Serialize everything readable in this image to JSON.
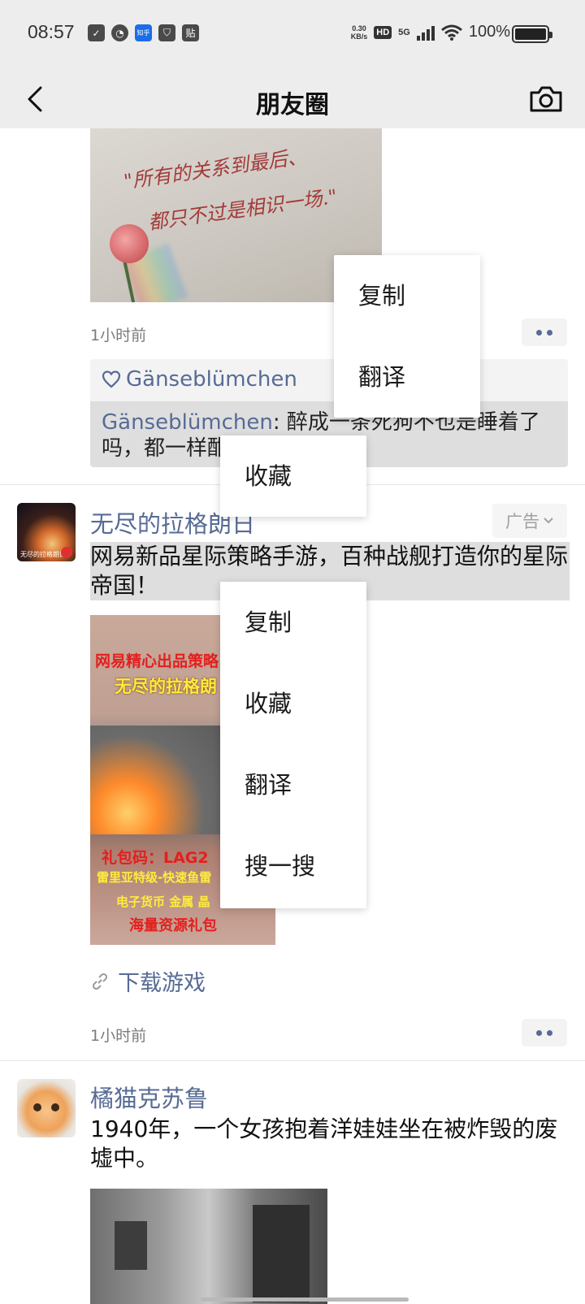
{
  "status_bar": {
    "time": "08:57",
    "left_icons": [
      "✓",
      "◔",
      "知乎",
      "⛉",
      "贴"
    ],
    "net_speed_value": "0.30",
    "net_speed_unit": "KB/s",
    "hd": "HD",
    "network": "5G",
    "battery_text": "100%"
  },
  "navbar": {
    "title": "朋友圈",
    "back_icon": "chevron-left",
    "camera_icon": "camera"
  },
  "post1": {
    "image_line1": "\"所有的关系到最后、",
    "image_line2": "都只不过是相识一场.\"",
    "time": "1小时前",
    "like_name": "Gänseblümchen",
    "comment_author": "Gänseblümchen",
    "comment_sep": ": ",
    "comment_text": "醉成一条死狗不也是睡着了吗，都一样酣"
  },
  "post2": {
    "avatar_text": "无尽的拉格朗日",
    "author": "无尽的拉格朗日",
    "ad_label": "广告",
    "text": "网易新品星际策略手游，百种战舰打造你的星际帝国！",
    "image": {
      "t1": "网易精心出品策略",
      "t2": "无尽的拉格朗",
      "t3": "礼包码：LAG2",
      "t4": "雷里亚特级-快速鱼雷",
      "t5": "电子货币 金属 晶",
      "t6": "海量资源礼包"
    },
    "link_text": "下载游戏",
    "time": "1小时前"
  },
  "post3": {
    "author": "橘猫克苏鲁",
    "text": "1940年，一个女孩抱着洋娃娃坐在被炸毁的废墟中。"
  },
  "menu_a": {
    "items": [
      "复制",
      "翻译"
    ]
  },
  "menu_b": {
    "items": [
      "收藏"
    ]
  },
  "menu_c": {
    "items": [
      "复制",
      "收藏",
      "翻译",
      "搜一搜"
    ]
  },
  "colors": {
    "link_blue": "#576b95",
    "bar_bg": "#ededed",
    "highlight": "#dedede"
  }
}
